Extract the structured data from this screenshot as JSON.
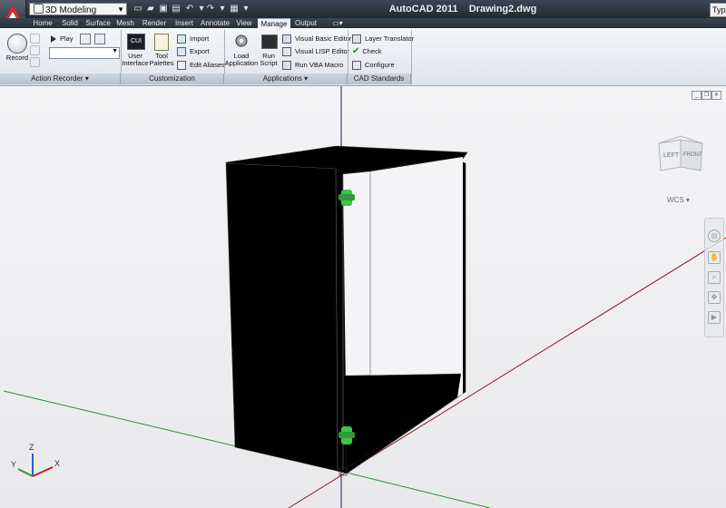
{
  "title_bar": {
    "app_title": "AutoCAD 2011",
    "drawing": "Drawing2.dwg",
    "workspace": "3D Modeling",
    "search_placeholder": "Typ"
  },
  "tabs": [
    "Home",
    "Solid",
    "Surface",
    "Mesh",
    "Render",
    "Insert",
    "Annotate",
    "View",
    "Manage",
    "Output"
  ],
  "active_tab": "Manage",
  "ribbon": {
    "action_recorder": {
      "record_label": "Record",
      "play_label": "Play",
      "footer": "Action Recorder"
    },
    "customization": {
      "cui_label": "CUI",
      "user_interface_label_1": "User",
      "user_interface_label_2": "Interface",
      "tool_palettes_label_1": "Tool",
      "tool_palettes_label_2": "Palettes",
      "import_label": "Import",
      "export_label": "Export",
      "edit_aliases_label": "Edit Aliases",
      "footer": "Customization"
    },
    "applications": {
      "load_application_label_1": "Load",
      "load_application_label_2": "Application",
      "run_script_label_1": "Run",
      "run_script_label_2": "Script",
      "vba_editor_label": "Visual Basic Editor",
      "lisp_editor_label": "Visual LISP Editor",
      "run_vba_label": "Run VBA Macro",
      "footer": "Applications"
    },
    "cad_standards": {
      "layer_translator_label": "Layer Translator",
      "check_label": "Check",
      "configure_label": "Configure",
      "footer": "CAD Standards"
    }
  },
  "viewport": {
    "viewcube_left": "LEFT",
    "viewcube_front": "FRONT",
    "wcs_label": "WCS",
    "ucs_x": "X",
    "ucs_y": "Y",
    "ucs_z": "Z"
  },
  "colors": {
    "viewport_bg": "#f4f4f6",
    "model_fill": "#000000",
    "grip_green": "#3fc24a",
    "y_axis": "#8b1a1a",
    "x_axis": "#2e8a2e"
  }
}
